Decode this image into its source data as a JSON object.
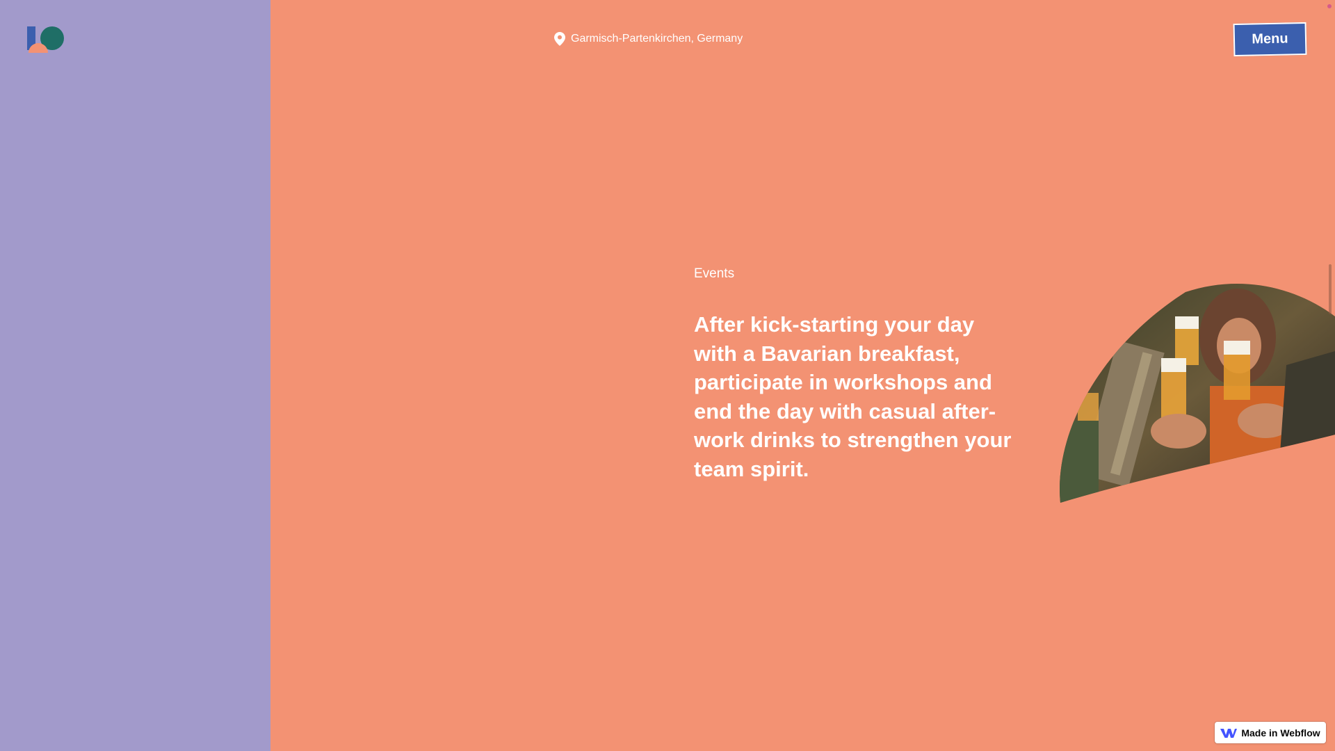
{
  "header": {
    "location_text": "Garmisch-Partenkirchen, Germany",
    "menu_label": "Menu"
  },
  "main": {
    "section_label": "Events",
    "headline": "After kick-starting your day with a Bavarian breakfast, participate in workshops and end the day with casual after-work drinks to strengthen your team spirit."
  },
  "badge": {
    "label": "Made in Webflow"
  },
  "icons": {
    "logo": "brand-logo",
    "location": "map-pin-icon",
    "webflow": "webflow-logo-icon"
  },
  "colors": {
    "left_panel": "#a29acb",
    "background": "#f39273",
    "menu_button": "#3b5fae",
    "logo_teal": "#1f6e66",
    "logo_blue": "#3b5fae",
    "logo_coral": "#f39273"
  }
}
